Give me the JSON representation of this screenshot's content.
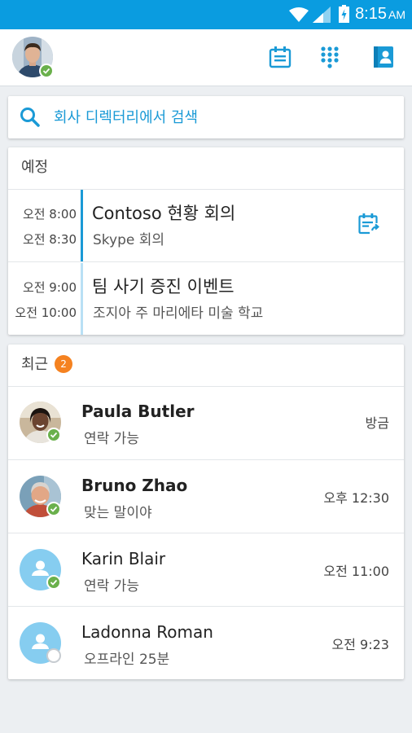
{
  "status_bar": {
    "time": "8:15",
    "ampm": "AM"
  },
  "header": {
    "icons": [
      "meetings-icon",
      "dialpad-icon",
      "contacts-icon"
    ]
  },
  "search": {
    "placeholder": "회사 디렉터리에서 검색"
  },
  "meetings": {
    "title": "예정",
    "items": [
      {
        "start": "오전 8:00",
        "end": "오전 8:30",
        "title": "Contoso 현황 회의",
        "subtitle": "Skype 회의",
        "has_join": true
      },
      {
        "start": "오전 9:00",
        "end": "오전 10:00",
        "title": "팀 사기 증진 이벤트",
        "subtitle": "조지아 주 마리에타 미술 학교",
        "has_join": false
      }
    ]
  },
  "recent": {
    "title": "최근",
    "badge": "2",
    "items": [
      {
        "name": "Paula Butler",
        "status": "연락 가능",
        "time": "방금",
        "unread": true,
        "presence": "available"
      },
      {
        "name": "Bruno Zhao",
        "status": "맞는 말이야",
        "time": "오후 12:30",
        "unread": true,
        "presence": "available"
      },
      {
        "name": "Karin Blair",
        "status": "연락 가능",
        "time": "오전 11:00",
        "unread": false,
        "presence": "available"
      },
      {
        "name": "Ladonna Roman",
        "status": "오프라인 25분",
        "time": "오전 9:23",
        "unread": false,
        "presence": "offline"
      }
    ]
  },
  "colors": {
    "accent": "#0a9ce0",
    "available": "#6ab04c",
    "badge": "#f58220"
  }
}
